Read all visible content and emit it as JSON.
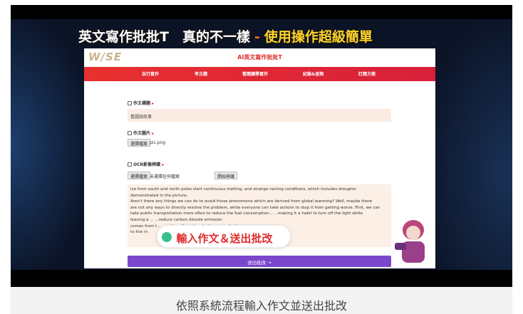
{
  "banner": {
    "left_text": "英文寫作批批T　真的不一樣",
    "separator": "-",
    "right_text": "使用操作超級簡單"
  },
  "app": {
    "logo": "W/SE",
    "title": "AI英文寫作批批T",
    "nav": [
      "自行寫作",
      "考古題",
      "看閱讀學寫作",
      "紀錄&查詢",
      "訂閱方案"
    ],
    "essay_title_label": "作文標題",
    "essay_title_value": "看圖說故事",
    "essay_image_label": "作文圖片",
    "choose_file_label": "選擇檔案",
    "image_file_name": "pic.png",
    "ocr_label": "OCR影像辨識",
    "ocr_file_status": "未選擇任何檔案",
    "ocr_start_button": "開始辨識",
    "essay_lines": [
      "ice from south and north poles start continuous melting, and strange raining conditions, which includes droughts",
      "demonstrated in the picture.",
      "      Aren't there any things we can do to avoid those phenomena which are derived from global warming? Well, maybe there",
      "are not any ways to directly resolve the problem, while everyone can take actions to stop it from getting worse. First, we can",
      "take public transportation more often to reduce the fuel consumption...         ...making it a habit to turn off the light while",
      "leaving a ...                                                                                          ...reduce carbon dioxide emission",
      "comes from t...                                                                          ...re friendly and make it more suitable",
      "to live in."
    ],
    "overlay_text": "輸入作文＆送出批改",
    "submit_button": "送出批改 →"
  },
  "caption": "依照系統流程輸入作文並送出批改",
  "colors": {
    "nav_red": "#e02c2c",
    "submit_purple": "#7a46cc",
    "field_bg": "#faece3",
    "banner_yellow": "#ffd42a"
  }
}
